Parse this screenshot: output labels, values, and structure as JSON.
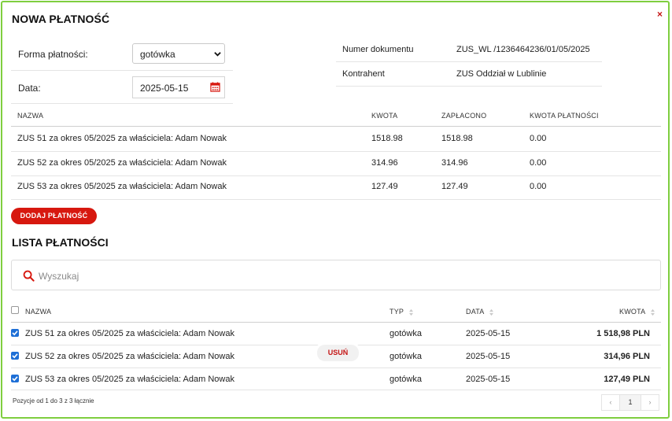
{
  "modal": {
    "title": "NOWA PŁATNOŚĆ",
    "close_label": "×"
  },
  "form": {
    "payment_method_label": "Forma płatności:",
    "payment_method_value": "gotówka",
    "date_label": "Data:",
    "date_value": "2025-05-15"
  },
  "meta": {
    "document_number_label": "Numer dokumentu",
    "document_number_value": "ZUS_WL /1236464236/01/05/2025",
    "contractor_label": "Kontrahent",
    "contractor_value": "ZUS Oddział w Lublinie"
  },
  "items_table": {
    "headers": [
      "NAZWA",
      "KWOTA",
      "ZAPŁACONO",
      "KWOTA PŁATNOŚCI"
    ],
    "rows": [
      {
        "name": "ZUS 51 za okres 05/2025 za właściciela: Adam Nowak",
        "amount": "1518.98",
        "paid": "1518.98",
        "payment_amount": "0.00"
      },
      {
        "name": "ZUS 52 za okres 05/2025 za właściciela: Adam Nowak",
        "amount": "314.96",
        "paid": "314.96",
        "payment_amount": "0.00"
      },
      {
        "name": "ZUS 53 za okres 05/2025 za właściciela: Adam Nowak",
        "amount": "127.49",
        "paid": "127.49",
        "payment_amount": "0.00"
      }
    ]
  },
  "add_payment_label": "DODAJ PŁATNOŚĆ",
  "payments": {
    "title": "LISTA PŁATNOŚCI",
    "search_placeholder": "Wyszukaj",
    "headers": {
      "name": "NAZWA",
      "type": "TYP",
      "date": "DATA",
      "amount": "KWOTA"
    },
    "rows": [
      {
        "checked": true,
        "name": "ZUS 51 za okres 05/2025 za właściciela: Adam Nowak",
        "type": "gotówka",
        "date": "2025-05-15",
        "amount": "1 518,98 PLN"
      },
      {
        "checked": true,
        "name": "ZUS 52 za okres 05/2025 za właściciela: Adam Nowak",
        "type": "gotówka",
        "date": "2025-05-15",
        "amount": "314,96 PLN"
      },
      {
        "checked": true,
        "name": "ZUS 53 za okres 05/2025 za właściciela: Adam Nowak",
        "type": "gotówka",
        "date": "2025-05-15",
        "amount": "127,49 PLN"
      }
    ],
    "delete_label": "USUŃ",
    "pagination_info": "Pozycje od 1 do 3 z 3 łącznie",
    "current_page": "1",
    "prev_label": "‹",
    "next_label": "›"
  },
  "colors": {
    "accent": "#d7180f",
    "border": "#7fce3f",
    "checkbox": "#1e6fd6"
  },
  "icons": {
    "calendar": "calendar-icon",
    "search": "search-icon",
    "close": "close-icon",
    "dropdown": "chevron-down-icon"
  }
}
